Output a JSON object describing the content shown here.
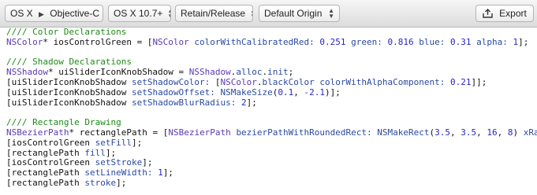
{
  "toolbar": {
    "language_platform": "OS X",
    "language_name": "Objective-C",
    "os_version": "OS X 10.7+",
    "memory_mode": "Retain/Release",
    "origin": "Default Origin",
    "export_label": "Export"
  },
  "code_lines": [
    [
      {
        "t": "//// Color Declarations",
        "c": "c"
      }
    ],
    [
      {
        "t": "NSColor",
        "c": "k"
      },
      {
        "t": "* iosControlGreen = [",
        "c": "p"
      },
      {
        "t": "NSColor",
        "c": "k"
      },
      {
        "t": " ",
        "c": "p"
      },
      {
        "t": "colorWithCalibratedRed:",
        "c": "m"
      },
      {
        "t": " ",
        "c": "p"
      },
      {
        "t": "0.251",
        "c": "n"
      },
      {
        "t": " ",
        "c": "p"
      },
      {
        "t": "green:",
        "c": "m"
      },
      {
        "t": " ",
        "c": "p"
      },
      {
        "t": "0.816",
        "c": "n"
      },
      {
        "t": " ",
        "c": "p"
      },
      {
        "t": "blue:",
        "c": "m"
      },
      {
        "t": " ",
        "c": "p"
      },
      {
        "t": "0.31",
        "c": "n"
      },
      {
        "t": " ",
        "c": "p"
      },
      {
        "t": "alpha:",
        "c": "m"
      },
      {
        "t": " ",
        "c": "p"
      },
      {
        "t": "1",
        "c": "n"
      },
      {
        "t": "];",
        "c": "p"
      }
    ],
    [],
    [
      {
        "t": "//// Shadow Declarations",
        "c": "c"
      }
    ],
    [
      {
        "t": "NSShadow",
        "c": "k"
      },
      {
        "t": "* uiSliderIconKnobShadow = ",
        "c": "p"
      },
      {
        "t": "NSShadow",
        "c": "k"
      },
      {
        "t": ".",
        "c": "p"
      },
      {
        "t": "alloc",
        "c": "m"
      },
      {
        "t": ".",
        "c": "p"
      },
      {
        "t": "init",
        "c": "m"
      },
      {
        "t": ";",
        "c": "p"
      }
    ],
    [
      {
        "t": "[uiSliderIconKnobShadow ",
        "c": "p"
      },
      {
        "t": "setShadowColor:",
        "c": "m"
      },
      {
        "t": " [",
        "c": "p"
      },
      {
        "t": "NSColor",
        "c": "k"
      },
      {
        "t": ".",
        "c": "p"
      },
      {
        "t": "blackColor",
        "c": "m"
      },
      {
        "t": " ",
        "c": "p"
      },
      {
        "t": "colorWithAlphaComponent:",
        "c": "m"
      },
      {
        "t": " ",
        "c": "p"
      },
      {
        "t": "0.21",
        "c": "n"
      },
      {
        "t": "]];",
        "c": "p"
      }
    ],
    [
      {
        "t": "[uiSliderIconKnobShadow ",
        "c": "p"
      },
      {
        "t": "setShadowOffset:",
        "c": "m"
      },
      {
        "t": " ",
        "c": "p"
      },
      {
        "t": "NSMakeSize",
        "c": "m"
      },
      {
        "t": "(",
        "c": "p"
      },
      {
        "t": "0.1",
        "c": "n"
      },
      {
        "t": ", ",
        "c": "p"
      },
      {
        "t": "-2.1",
        "c": "n"
      },
      {
        "t": ")];",
        "c": "p"
      }
    ],
    [
      {
        "t": "[uiSliderIconKnobShadow ",
        "c": "p"
      },
      {
        "t": "setShadowBlurRadius:",
        "c": "m"
      },
      {
        "t": " ",
        "c": "p"
      },
      {
        "t": "2",
        "c": "n"
      },
      {
        "t": "];",
        "c": "p"
      }
    ],
    [],
    [
      {
        "t": "//// Rectangle Drawing",
        "c": "c"
      }
    ],
    [
      {
        "t": "NSBezierPath",
        "c": "k"
      },
      {
        "t": "* rectanglePath = [",
        "c": "p"
      },
      {
        "t": "NSBezierPath",
        "c": "k"
      },
      {
        "t": " ",
        "c": "p"
      },
      {
        "t": "bezierPathWithRoundedRect:",
        "c": "m"
      },
      {
        "t": " ",
        "c": "p"
      },
      {
        "t": "NSMakeRect",
        "c": "m"
      },
      {
        "t": "(",
        "c": "p"
      },
      {
        "t": "3.5",
        "c": "n"
      },
      {
        "t": ", ",
        "c": "p"
      },
      {
        "t": "3.5",
        "c": "n"
      },
      {
        "t": ", ",
        "c": "p"
      },
      {
        "t": "16",
        "c": "n"
      },
      {
        "t": ", ",
        "c": "p"
      },
      {
        "t": "8",
        "c": "n"
      },
      {
        "t": ") ",
        "c": "p"
      },
      {
        "t": "xRa",
        "c": "m"
      }
    ],
    [
      {
        "t": "[iosControlGreen ",
        "c": "p"
      },
      {
        "t": "setFill",
        "c": "m"
      },
      {
        "t": "];",
        "c": "p"
      }
    ],
    [
      {
        "t": "[rectanglePath ",
        "c": "p"
      },
      {
        "t": "fill",
        "c": "m"
      },
      {
        "t": "];",
        "c": "p"
      }
    ],
    [
      {
        "t": "[iosControlGreen ",
        "c": "p"
      },
      {
        "t": "setStroke",
        "c": "m"
      },
      {
        "t": "];",
        "c": "p"
      }
    ],
    [
      {
        "t": "[rectanglePath ",
        "c": "p"
      },
      {
        "t": "setLineWidth:",
        "c": "m"
      },
      {
        "t": " ",
        "c": "p"
      },
      {
        "t": "1",
        "c": "n"
      },
      {
        "t": "];",
        "c": "p"
      }
    ],
    [
      {
        "t": "[rectanglePath ",
        "c": "p"
      },
      {
        "t": "stroke",
        "c": "m"
      },
      {
        "t": "];",
        "c": "p"
      }
    ]
  ]
}
